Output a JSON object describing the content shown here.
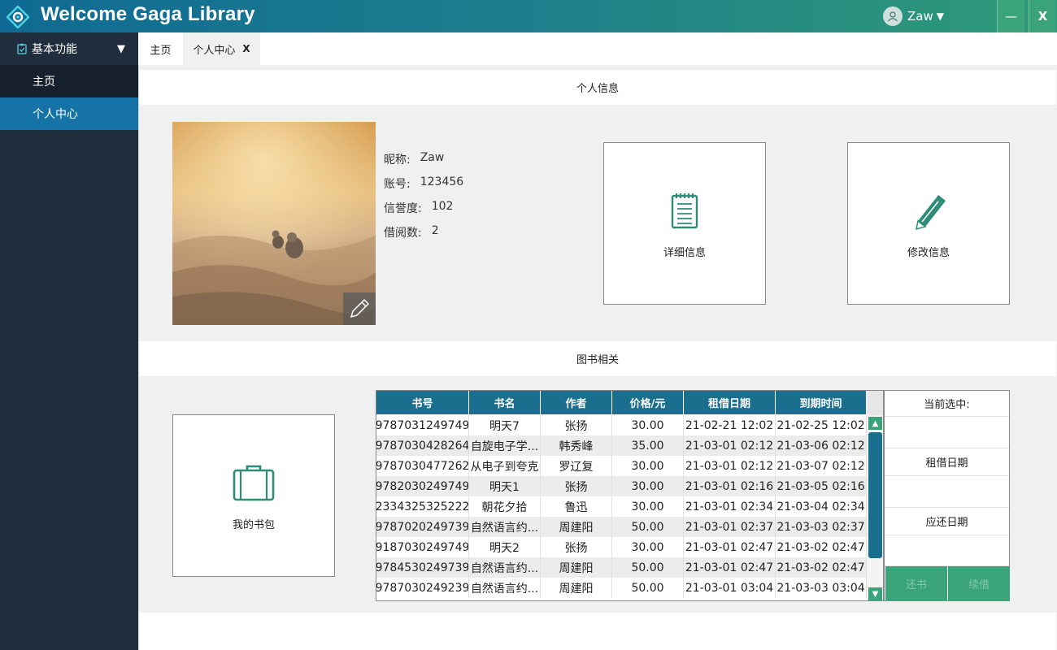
{
  "app": {
    "title": "Welcome Gaga Library",
    "user": "Zaw",
    "user_caret": "▼",
    "minimize": "—",
    "close": "X"
  },
  "sidebar": {
    "group": "基本功能",
    "group_caret": "▼",
    "items": [
      "主页",
      "个人中心"
    ]
  },
  "tabs": {
    "home": "主页",
    "center": "个人中心",
    "close": "X"
  },
  "sections": {
    "info": "个人信息",
    "books": "图书相关"
  },
  "profile": {
    "fields": [
      {
        "label": "昵称:",
        "value": "Zaw"
      },
      {
        "label": "账号:",
        "value": "123456"
      },
      {
        "label": "信誉度:",
        "value": "102"
      },
      {
        "label": "借阅数:",
        "value": " 2"
      }
    ]
  },
  "cards": {
    "detail": "详细信息",
    "edit": "修改信息",
    "bag": "我的书包"
  },
  "table": {
    "headers": [
      "书号",
      "书名",
      "作者",
      "价格/元",
      "租借日期",
      "到期时间"
    ],
    "rows": [
      [
        "9787031249749",
        "明天7",
        "张扬",
        "30.00",
        "21-02-21 12:02",
        "21-02-25 12:02"
      ],
      [
        "9787030428264",
        "自旋电子学...",
        "韩秀峰",
        "35.00",
        "21-03-01 02:12",
        "21-03-06 02:12"
      ],
      [
        "9787030477262",
        "从电子到夸克",
        "罗辽复",
        "30.00",
        "21-03-01 02:12",
        "21-03-07 02:12"
      ],
      [
        "9782030249749",
        "明天1",
        "张扬",
        "30.00",
        "21-03-01 02:16",
        "21-03-05 02:16"
      ],
      [
        "2334325325222",
        "朝花夕拾",
        "鲁迅",
        "30.00",
        "21-03-01 02:34",
        "21-03-04 02:34"
      ],
      [
        "9787020249739",
        "自然语言约...",
        "周建阳",
        "50.00",
        "21-03-01 02:37",
        "21-03-03 02:37"
      ],
      [
        "9187030249749",
        "明天2",
        "张扬",
        "30.00",
        "21-03-01 02:47",
        "21-03-02 02:47"
      ],
      [
        "9784530249739",
        "自然语言约...",
        "周建阳",
        "50.00",
        "21-03-01 02:47",
        "21-03-02 02:47"
      ],
      [
        "9787030249239",
        "自然语言约...",
        "周建阳",
        "50.00",
        "21-03-01 03:04",
        "21-03-03 03:04"
      ]
    ]
  },
  "selection": {
    "title": "当前选中:",
    "rent_date": "租借日期",
    "due_date": "应还日期",
    "return_btn": "还书",
    "renew_btn": "续借"
  },
  "colors": {
    "accent": "#1a6f8f",
    "green": "#3aa37a",
    "sidebar": "#1f2d3d",
    "sidebar_active": "#1673a8"
  }
}
